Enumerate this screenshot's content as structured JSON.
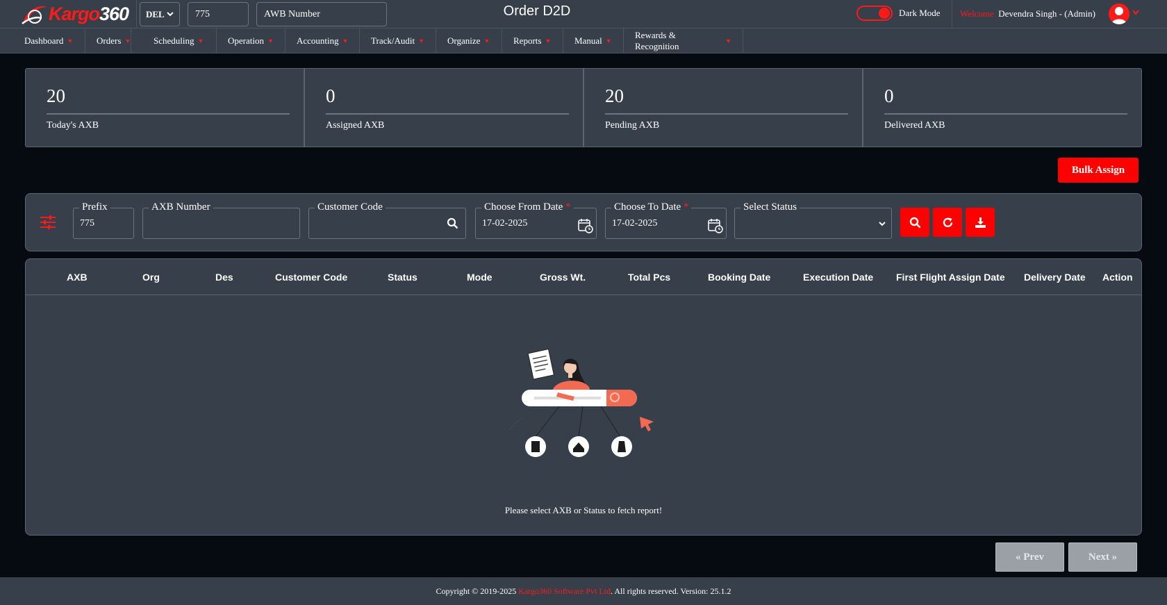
{
  "header": {
    "logo_prefix": "Kargo",
    "logo_suffix": "360",
    "station": "DEL",
    "prefix_value": "775",
    "awb_placeholder": "AWB Number",
    "page_title": "Order D2D",
    "dark_mode_label": "Dark Mode",
    "welcome_label": "Welcome",
    "user_name": "Devendra Singh - (Admin)"
  },
  "nav": {
    "items": [
      "Dashboard",
      "Orders",
      "Scheduling",
      "Operation",
      "Accounting",
      "Track/Audit",
      "Organize",
      "Reports",
      "Manual",
      "Rewards & Recognition"
    ]
  },
  "stats": [
    {
      "value": "20",
      "label": "Today's AXB"
    },
    {
      "value": "0",
      "label": "Assigned AXB"
    },
    {
      "value": "20",
      "label": "Pending AXB"
    },
    {
      "value": "0",
      "label": "Delivered AXB"
    }
  ],
  "bulk_assign_label": "Bulk Assign",
  "filters": {
    "prefix_label": "Prefix",
    "prefix_value": "775",
    "axb_label": "AXB Number",
    "axb_value": "",
    "customer_label": "Customer Code",
    "customer_value": "",
    "from_label": "Choose From Date",
    "from_value": "17-02-2025",
    "to_label": "Choose To Date",
    "to_value": "17-02-2025",
    "status_label": "Select Status",
    "status_value": "",
    "required_mark": "*"
  },
  "table": {
    "columns": [
      "AXB",
      "Org",
      "Des",
      "Customer Code",
      "Status",
      "Mode",
      "Gross Wt.",
      "Total Pcs",
      "Booking Date",
      "Execution Date",
      "First Flight Assign Date",
      "Delivery Date",
      "Action"
    ],
    "empty_message": "Please select AXB or Status to fetch report!"
  },
  "pager": {
    "prev_label": "Prev",
    "next_label": "Next"
  },
  "footer": {
    "copyright": "Copyright © 2019-2025",
    "company": "Kargo360 Software Pvt Ltd",
    "rest": ". All rights reserved. Version: 25.1.2"
  },
  "colors": {
    "accent": "#ff0000",
    "panel": "#363f4a",
    "background": "#060b12"
  }
}
